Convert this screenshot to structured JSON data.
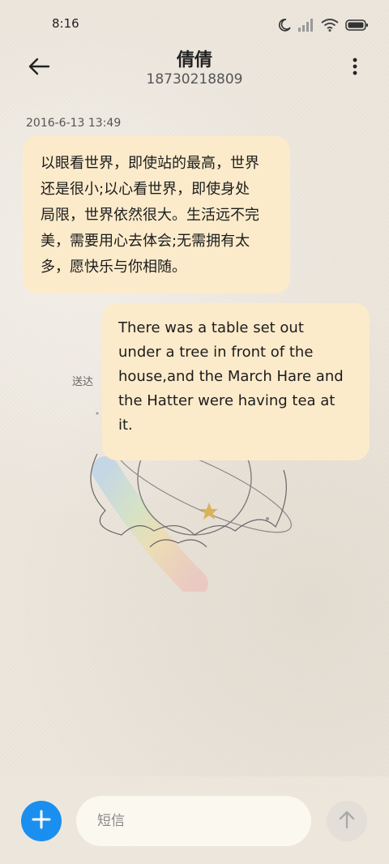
{
  "status_bar": {
    "time": "8:16",
    "icons": [
      "moon-icon",
      "signal-icon",
      "wifi-icon",
      "battery-icon"
    ]
  },
  "header": {
    "contact_name": "倩倩",
    "contact_number": "18730218809",
    "back_icon": "back-arrow-icon",
    "more_icon": "more-vertical-icon"
  },
  "conversation": {
    "timestamp": "2016-6-13 13:49",
    "messages": [
      {
        "direction": "incoming",
        "lines": [
          "以眼看世界，即使站的最高，世界",
          "还是很小;以心看世界，即使身处",
          "局限，世界依然很大。生活远不完",
          "美，需要用心去体会;无需拥有太",
          "多，愿快乐与你相随。"
        ]
      },
      {
        "direction": "outgoing",
        "lines": [
          "There was a table set out",
          "under a tree in front of the",
          "house,and the March Hare and",
          "the Hatter were having tea at",
          "it."
        ],
        "status": "送达"
      }
    ]
  },
  "composer": {
    "add_icon": "plus-icon",
    "placeholder": "短信",
    "value": "",
    "send_icon": "send-arrow-up-icon"
  },
  "colors": {
    "accent": "#1a8ff0",
    "bubble": "#fcebcb",
    "background": "#ece6dc"
  }
}
